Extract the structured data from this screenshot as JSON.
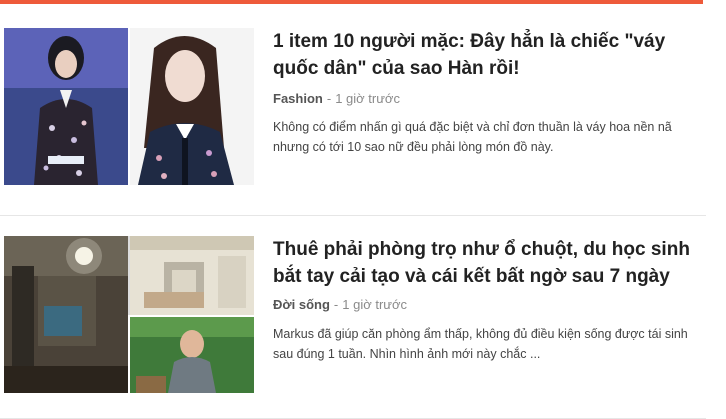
{
  "articles": [
    {
      "title": "1 item 10 người mặc: Đây hẳn là chiếc \"váy quốc dân\" của sao Hàn rồi!",
      "category": "Fashion",
      "separator": "-",
      "time": "1 giờ trước",
      "summary": "Không có điểm nhấn gì quá đặc biệt và chỉ đơn thuần là váy hoa nền nã nhưng có tới 10 sao nữ đều phải lòng món đồ này."
    },
    {
      "title": "Thuê phải phòng trọ như ổ chuột, du học sinh bắt tay cải tạo và cái kết bất ngờ sau 7 ngày",
      "category": "Đời sống",
      "separator": "-",
      "time": "1 giờ trước",
      "summary": "Markus đã giúp căn phòng ẩm thấp, không đủ điều kiện sống được tái sinh sau đúng 1 tuần. Nhìn hình ảnh mới này chắc ..."
    }
  ],
  "colors": {
    "accent": "#ee5a3a",
    "title": "#222222",
    "meta": "#8a8a8a"
  }
}
